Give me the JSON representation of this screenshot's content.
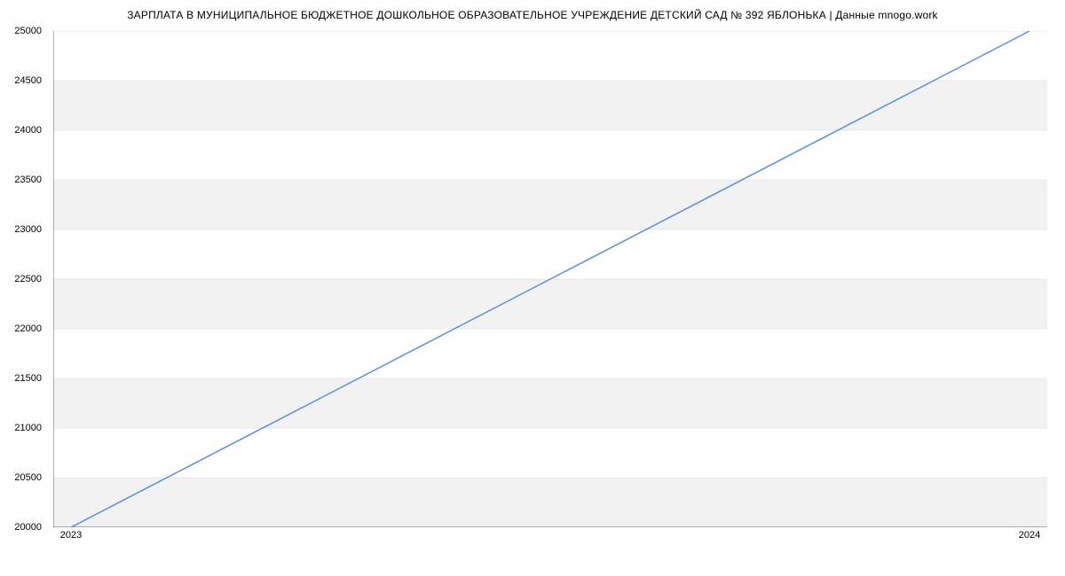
{
  "chart_data": {
    "type": "line",
    "title": "ЗАРПЛАТА В МУНИЦИПАЛЬНОЕ БЮДЖЕТНОЕ ДОШКОЛЬНОЕ ОБРАЗОВАТЕЛЬНОЕ УЧРЕЖДЕНИЕ ДЕТСКИЙ САД № 392 ЯБЛОНЬКА | Данные mnogo.work",
    "x": [
      2023,
      2024
    ],
    "values": [
      20000,
      25000
    ],
    "xlabel": "",
    "ylabel": "",
    "ylim": [
      20000,
      25000
    ],
    "y_ticks": [
      20000,
      20500,
      21000,
      21500,
      22000,
      22500,
      23000,
      23500,
      24000,
      24500,
      25000
    ],
    "x_ticks": [
      2023,
      2024
    ],
    "line_color": "#5b8fd6",
    "grid": true
  }
}
